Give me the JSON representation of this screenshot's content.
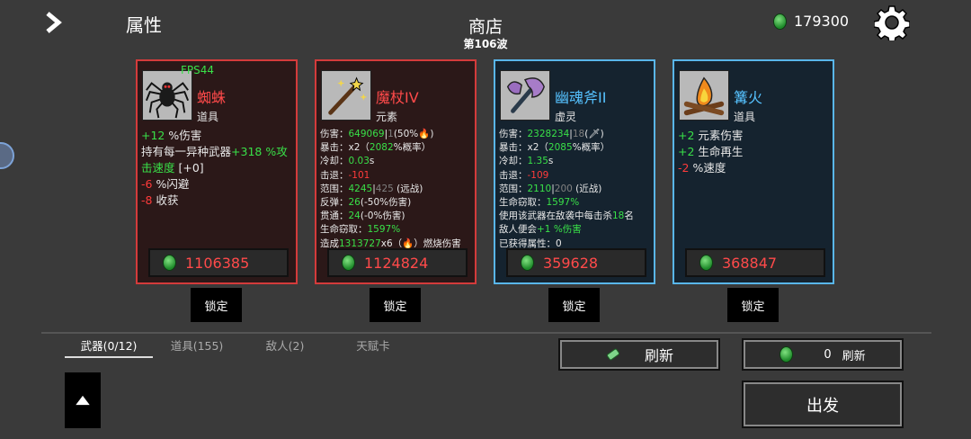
{
  "header": {
    "attributes_label": "属性",
    "shop_title": "商店",
    "wave": "第106波",
    "money": "179300"
  },
  "cards": [
    {
      "fps": "FPS44",
      "name": "蜘蛛",
      "type": "道具",
      "price": "1106385",
      "icon": "spider-icon"
    },
    {
      "name": "魔杖IV",
      "type": "元素",
      "price": "1124824",
      "icon": "wand-icon"
    },
    {
      "name": "幽魂斧II",
      "type": "虚灵",
      "price": "359628",
      "icon": "axe-icon"
    },
    {
      "name": "篝火",
      "type": "道具",
      "price": "368847",
      "icon": "campfire-icon"
    }
  ],
  "lock_label": "锁定",
  "tabs": [
    "武器(0/12)",
    "道具(155)",
    "敌人(2)",
    "天赋卡"
  ],
  "refresh_label": "刷新",
  "free_refresh": {
    "count": "0",
    "label": "刷新"
  },
  "depart_label": "出发",
  "colors": {
    "red_border": "#d43b3b",
    "blue_border": "#59b6ea",
    "green_text": "#39e048",
    "red_text": "#ff3b3b"
  }
}
